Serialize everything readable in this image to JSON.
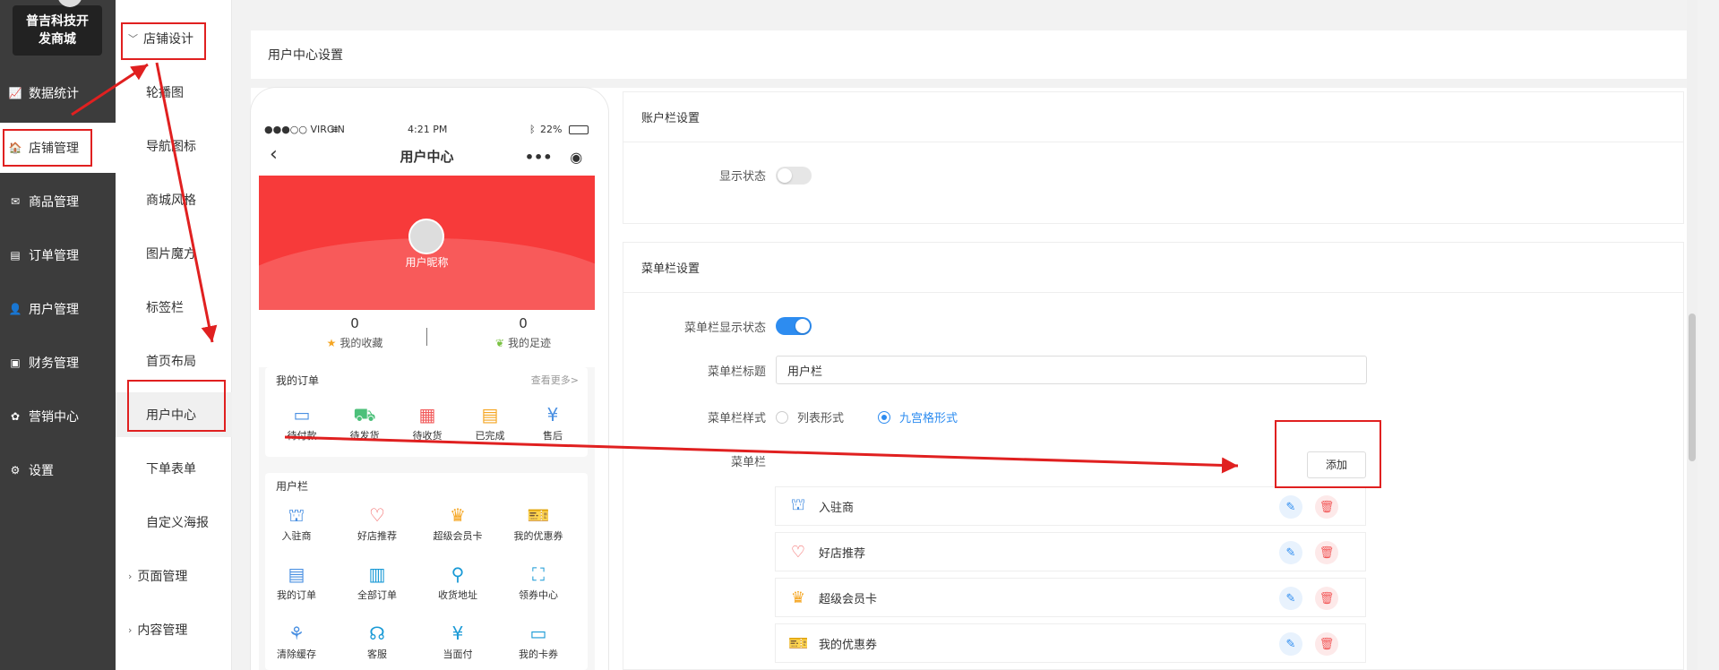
{
  "brand": {
    "name": "普吉科技开发商城"
  },
  "sidebar": {
    "items": [
      {
        "icon": "chart-icon",
        "label": "数据统计"
      },
      {
        "icon": "store-icon",
        "label": "店铺管理"
      },
      {
        "icon": "mail-icon",
        "label": "商品管理"
      },
      {
        "icon": "list-icon",
        "label": "订单管理"
      },
      {
        "icon": "user-icon",
        "label": "用户管理"
      },
      {
        "icon": "finance-icon",
        "label": "财务管理"
      },
      {
        "icon": "marketing-icon",
        "label": "营销中心"
      },
      {
        "icon": "gear-icon",
        "label": "设置"
      }
    ]
  },
  "submenu": {
    "group_design": "店铺设计",
    "items": [
      "轮播图",
      "导航图标",
      "商城风格",
      "图片魔方",
      "标签栏",
      "首页布局",
      "用户中心",
      "下单表单",
      "自定义海报"
    ],
    "group_page": "页面管理",
    "group_content": "内容管理"
  },
  "page": {
    "title": "用户中心设置"
  },
  "phone": {
    "carrier": "●●●○○ VIRGIN",
    "time": "4:21 PM",
    "battery": "22%",
    "title": "用户中心",
    "nickname": "用户昵称",
    "stats": [
      {
        "value": "0",
        "label": "我的收藏"
      },
      {
        "value": "0",
        "label": "我的足迹"
      }
    ],
    "orders": {
      "title": "我的订单",
      "more": "查看更多>",
      "items": [
        "待付款",
        "待发货",
        "待收货",
        "已完成",
        "售后"
      ]
    },
    "user_bar": {
      "title": "用户栏",
      "items": [
        "入驻商",
        "好店推荐",
        "超级会员卡",
        "我的优惠券",
        "我的订单",
        "全部订单",
        "收货地址",
        "领券中心",
        "清除缓存",
        "客服",
        "当面付",
        "我的卡券"
      ]
    }
  },
  "account_section": {
    "title": "账户栏设置",
    "display_label": "显示状态",
    "display_on": false
  },
  "menu_section": {
    "title": "菜单栏设置",
    "display_label": "菜单栏显示状态",
    "display_on": true,
    "title_label": "菜单栏标题",
    "title_value": "用户栏",
    "style_label": "菜单栏样式",
    "style_options": [
      "列表形式",
      "九宫格形式"
    ],
    "style_selected": "九宫格形式",
    "menu_label": "菜单栏",
    "add_label": "添加",
    "rows": [
      "入驻商",
      "好店推荐",
      "超级会员卡",
      "我的优惠券"
    ]
  },
  "colors": {
    "accent": "#2d8cf0",
    "banner": "#f73a3a",
    "highlight": "#e02020"
  }
}
